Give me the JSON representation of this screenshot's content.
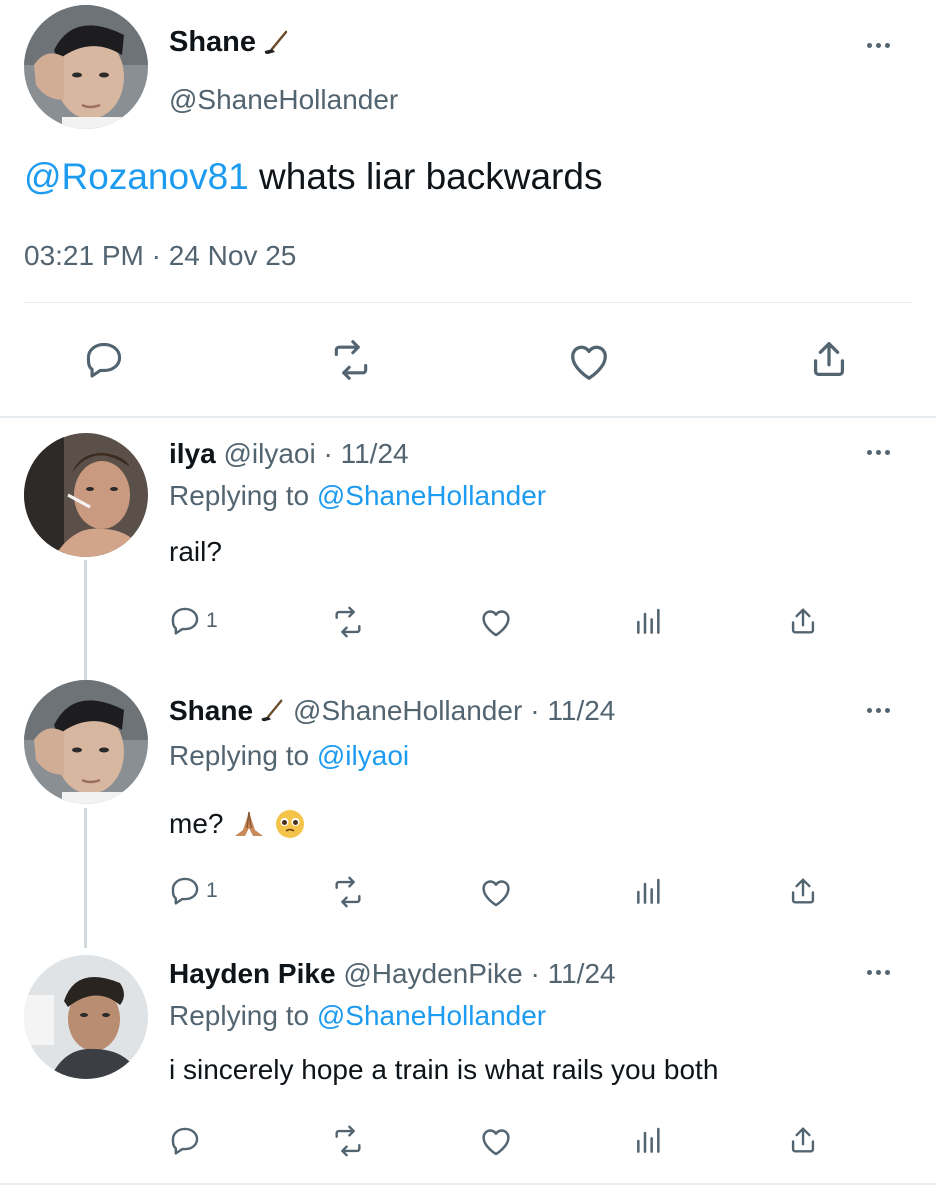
{
  "main_tweet": {
    "display_name": "Shane",
    "name_badge": "hockey-stick-icon",
    "handle": "@ShaneHollander",
    "mention": "@Rozanov81",
    "text": "whats liar backwards",
    "timestamp": "03:21 PM · 24 Nov 25"
  },
  "replies": [
    {
      "display_name": "ilya",
      "handle": "@ilyaoi",
      "date": "· 11/24",
      "replying_prefix": "Replying to ",
      "replying_to": "@ShaneHollander",
      "text": "rail?",
      "reply_count": "1"
    },
    {
      "display_name": "Shane",
      "name_badge": "hockey-stick-icon",
      "handle": "@ShaneHollander",
      "date": "· 11/24",
      "replying_prefix": "Replying to ",
      "replying_to": "@ilyaoi",
      "text": "me?",
      "emojis": [
        "folded-hands-emoji",
        "pleading-face-emoji"
      ],
      "reply_count": "1"
    },
    {
      "display_name": "Hayden Pike",
      "handle": "@HaydenPike",
      "date": "· 11/24",
      "replying_prefix": "Replying to ",
      "replying_to": "@ShaneHollander",
      "text": "i sincerely hope a train is what rails you both"
    }
  ],
  "colors": {
    "link_blue": "#1d9bf0",
    "muted_gray": "#536471",
    "divider": "#e6ecf0"
  }
}
